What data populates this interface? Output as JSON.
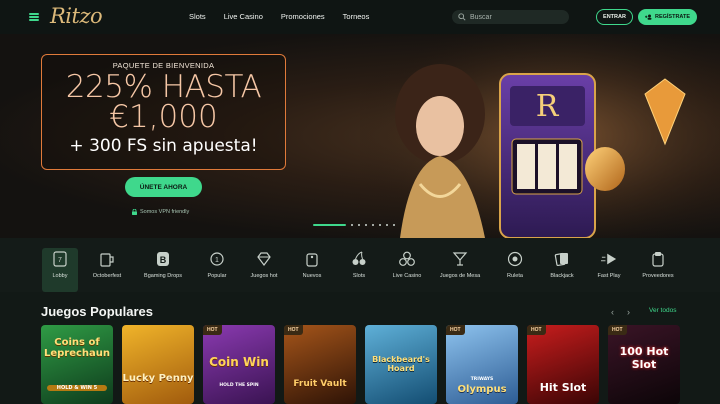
{
  "header": {
    "logo": "Ritzo",
    "nav": [
      "Slots",
      "Live Casino",
      "Promociones",
      "Torneos"
    ],
    "search_placeholder": "Buscar",
    "login_label": "ENTRAR",
    "register_label": "REGÍSTRATE"
  },
  "hero": {
    "tag": "PAQUETE DE BIENVENIDA",
    "line1": "225% HASTA",
    "line2": "€1,000",
    "line3": "+ 300 FS sin apuesta!",
    "cta": "ÚNETE AHORA",
    "vpn_note": "Somos VPN friendly",
    "slider": {
      "total": 8,
      "active": 0
    }
  },
  "categories": [
    {
      "label": "Lobby",
      "icon": "lobby-card-icon",
      "active": true
    },
    {
      "label": "Octoberfest",
      "icon": "beer-mug-icon"
    },
    {
      "label": "Bgaming Drops",
      "icon": "bgaming-b-icon"
    },
    {
      "label": "Popular",
      "icon": "popular-medal-icon"
    },
    {
      "label": "Juegos hot",
      "icon": "diamond-icon"
    },
    {
      "label": "Nuevos",
      "icon": "new-tag-icon"
    },
    {
      "label": "Slots",
      "icon": "cherries-icon"
    },
    {
      "label": "Live Casino",
      "icon": "chips-icon"
    },
    {
      "label": "Juegos de Mesa",
      "icon": "cocktail-icon"
    },
    {
      "label": "Ruleta",
      "icon": "roulette-icon"
    },
    {
      "label": "Blackjack",
      "icon": "playing-cards-icon"
    },
    {
      "label": "Fast Play",
      "icon": "fast-play-icon"
    },
    {
      "label": "Proveedores",
      "icon": "providers-icon"
    }
  ],
  "section": {
    "title": "Juegos Populares",
    "see_all": "Ver todos",
    "prev": "‹",
    "next": "›"
  },
  "games": [
    {
      "title": "Coins of Leprechaun",
      "hot": false,
      "badge": "",
      "sub": "HOLD & WIN 5",
      "bg": "#1d6b2e"
    },
    {
      "title": "Lucky Penny",
      "hot": false,
      "badge": "",
      "sub": "",
      "bg": "#c98a1f"
    },
    {
      "title": "Coin Win",
      "hot": true,
      "badge": "HOT",
      "sub": "HOLD THE SPIN",
      "bg": "#5a2478"
    },
    {
      "title": "Fruit Vault",
      "hot": true,
      "badge": "HOT",
      "sub": "",
      "bg": "#5e2b10"
    },
    {
      "title": "Blackbeard's Hoard",
      "hot": false,
      "badge": "",
      "sub": "",
      "bg": "#2b6f9c"
    },
    {
      "title": "Olympus",
      "hot": true,
      "badge": "HOT",
      "sub": "TRIWAYS",
      "bg": "#4a7fb8"
    },
    {
      "title": "Hit Slot",
      "hot": true,
      "badge": "HOT",
      "sub": "",
      "bg": "#7a1010"
    },
    {
      "title": "100 Hot Slot",
      "hot": true,
      "badge": "HOT",
      "sub": "",
      "bg": "#1a0c14"
    }
  ],
  "colors": {
    "accent": "#3fd88c",
    "promo_border": "#e07a3a",
    "bg": "#121916"
  }
}
